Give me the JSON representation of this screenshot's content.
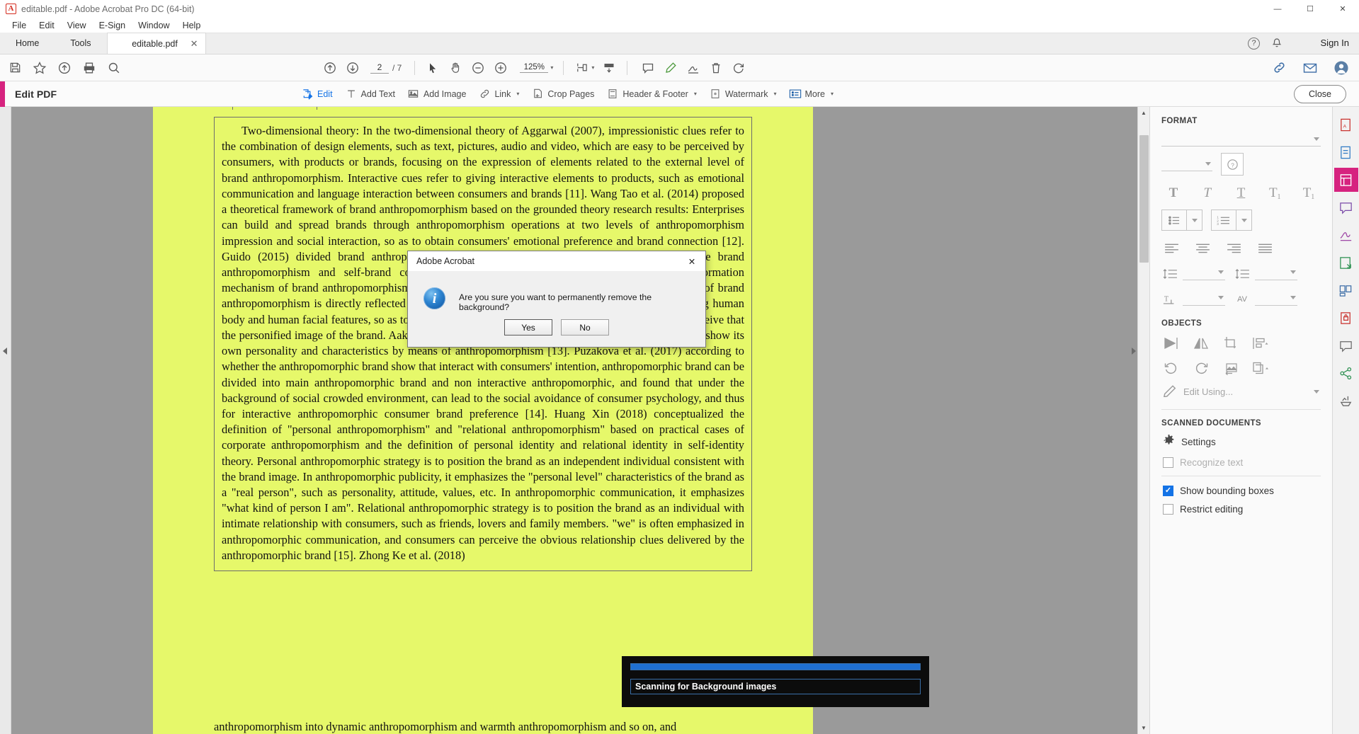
{
  "window": {
    "title": "editable.pdf - Adobe Acrobat Pro DC (64-bit)",
    "app_icon": "acrobat-icon",
    "minimize": "—",
    "maximize": "☐",
    "close": "✕"
  },
  "menubar": {
    "items": [
      "File",
      "Edit",
      "View",
      "E-Sign",
      "Window",
      "Help"
    ]
  },
  "tabs": {
    "home": "Home",
    "tools": "Tools",
    "document": "editable.pdf",
    "close_glyph": "✕",
    "sign_in": "Sign In",
    "help_icon": "?",
    "bell_icon": "bell-icon"
  },
  "toolbar": {
    "left_icons": [
      "save-icon",
      "star-icon",
      "upload-cloud-icon",
      "print-icon",
      "search-icon"
    ],
    "page_up_icon": "page-up-icon",
    "page_down_icon": "page-down-icon",
    "page_current": "2",
    "page_total": "/ 7",
    "select_icon": "select-cursor-icon",
    "hand_icon": "hand-tool-icon",
    "zoom_out_icon": "zoom-out-icon",
    "zoom_in_icon": "zoom-in-icon",
    "zoom_level": "125%",
    "zoom_caret": "▾",
    "fit_page_icon": "fit-page-icon",
    "fit_caret": "▾",
    "scroll_mode_icon": "scroll-mode-icon",
    "comment_icon": "comment-icon",
    "highlight_icon": "highlight-pen-icon",
    "sign_icon": "sign-icon",
    "delete_icon": "trash-icon",
    "rotate_icon": "rotate-icon",
    "link_share_icon": "share-link-icon",
    "mail_icon": "envelope-icon",
    "account_icon": "account-icon"
  },
  "edit_pdf_bar": {
    "title": "Edit PDF",
    "tools": [
      {
        "label": "Edit",
        "icon": "edit-pdf-icon",
        "active": true,
        "caret": ""
      },
      {
        "label": "Add Text",
        "icon": "add-text-icon",
        "active": false,
        "caret": ""
      },
      {
        "label": "Add Image",
        "icon": "add-image-icon",
        "active": false,
        "caret": ""
      },
      {
        "label": "Link",
        "icon": "link-icon",
        "active": false,
        "caret": "▾"
      },
      {
        "label": "Crop Pages",
        "icon": "crop-pages-icon",
        "active": false,
        "caret": ""
      },
      {
        "label": "Header & Footer",
        "icon": "header-footer-icon",
        "active": false,
        "caret": "▾"
      },
      {
        "label": "Watermark",
        "icon": "watermark-icon",
        "active": false,
        "caret": "▾"
      },
      {
        "label": "More",
        "icon": "more-icon",
        "active": false,
        "caret": "▾"
      }
    ],
    "close_label": "Close"
  },
  "document": {
    "body_text": "Two-dimensional theory: In the two-dimensional theory of Aggarwal (2007), impressionistic clues refer to the combination of design elements, such as text, pictures, audio and video, which are easy to be perceived by consumers, with products or brands, focusing on the expression of elements related to the external level of brand anthropomorphism. Interactive cues refer to giving interactive elements to products, such as emotional communication and language interaction between consumers and brands [11]. Wang Tao et al. (2014) proposed a theoretical framework of brand anthropomorphism based on the grounded theory research results: Enterprises can build and spread brands through anthropomorphism operations at two levels of anthropomorphism impression and social interaction, so as to obtain consumers' emotional preference and brand connection [12]. Guido (2015) divided brand anthropomorphism into product brand anthropomorphism, corporate brand anthropomorphism and self-brand consistency brand anthropomorphism, and discussed the formation mechanism of brand anthropomorphism in his study. The study found that the formation mechanism of brand anthropomorphism is directly reflected in the product shape design of the enterprise, including having human body and human facial features, so as to make the personified image of the brand make consumers perceive that the personified image of the brand. Aaker (1997) pointed out that the personified image of a brand can show its own personality and characteristics by means of anthropomorphism [13]. Puzakova et al. (2017) according to whether the anthropomorphic brand show that interact with consumers' intention, anthropomorphic brand can be divided into main anthropomorphic brand and non interactive anthropomorphic, and found that under the background of social crowded environment, can lead to the social avoidance of consumer psychology, and thus for interactive anthropomorphic consumer brand preference [14]. Huang Xin (2018) conceptualized the definition of \"personal anthropomorphism\" and \"relational anthropomorphism\" based on practical cases of corporate anthropomorphism and the definition of personal identity and relational identity in self-identity theory. Personal anthropomorphic strategy is to position the brand as an independent individual consistent with the brand image. In anthropomorphic publicity, it emphasizes the \"personal level\" characteristics of the brand as a \"real person\", such as personality, attitude, values, etc. In anthropomorphic communication, it emphasizes \"what kind of person I am\". Relational anthropomorphic strategy is to position the brand as an individual with intimate relationship with consumers, such as friends, lovers and family members. \"we\" is often emphasized in anthropomorphic communication, and consumers can perceive the obvious relationship clues delivered by the anthropomorphic brand [15]. Zhong Ke et al. (2018)",
    "clipped_line": "anthropomorphism into dynamic anthropomorphism and warmth anthropomorphism and so on, and",
    "highlight_color": "#e6f86a"
  },
  "dialog": {
    "title": "Adobe Acrobat",
    "close_glyph": "✕",
    "icon": "info-icon",
    "message": "Are you sure you want to permanently remove the background?",
    "yes_label": "Yes",
    "no_label": "No"
  },
  "right_panel": {
    "format": {
      "heading": "FORMAT",
      "font_value": "",
      "font_caret": "▾",
      "size_value": "",
      "size_caret": "▾",
      "color_icon": "color-picker-icon",
      "text_styles": [
        {
          "icon": "bold-icon",
          "glyph": "T"
        },
        {
          "icon": "italic-icon",
          "glyph": "T"
        },
        {
          "icon": "underline-icon",
          "glyph": "T"
        },
        {
          "icon": "superscript-icon",
          "glyph": "T"
        },
        {
          "icon": "subscript-icon",
          "glyph": "T"
        }
      ],
      "bullet_list_icon": "bullet-list-icon",
      "numbered_list_icon": "numbered-list-icon",
      "align_icons": [
        "align-left-icon",
        "align-center-icon",
        "align-right-icon",
        "align-justify-icon"
      ],
      "line_spacing_icon": "line-spacing-icon",
      "paragraph_spacing_icon": "paragraph-spacing-icon",
      "char_spacing_icon": "character-spacing-icon",
      "word_spacing_icon": "word-spacing-icon",
      "av_label": "AV",
      "horizontal_scale_icon": "horizontal-scale-icon"
    },
    "objects": {
      "heading": "OBJECTS",
      "icons_row1": [
        "flip-vertical-icon",
        "flip-horizontal-icon",
        "crop-object-icon",
        "align-objects-icon"
      ],
      "icons_row2": [
        "rotate-ccw-icon",
        "rotate-cw-icon",
        "replace-image-icon",
        "arrange-icon"
      ],
      "edit_using_label": "Edit Using...",
      "edit_using_icon": "pencil-icon",
      "edit_using_caret": "▾"
    },
    "scanned_documents": {
      "heading": "SCANNED DOCUMENTS",
      "settings_label": "Settings",
      "settings_icon": "gear-icon",
      "recognize_text_label": "Recognize text",
      "recognize_text_checked": false
    },
    "options": [
      {
        "label": "Show bounding boxes",
        "checked": true
      },
      {
        "label": "Restrict editing",
        "checked": false
      }
    ]
  },
  "icon_rail": {
    "items": [
      "export-pdf-icon",
      "create-pdf-icon",
      "edit-pdf-icon",
      "comment-icon",
      "fill-sign-icon",
      "send-review-icon",
      "organize-pages-icon",
      "protect-icon",
      "chat-icon",
      "share-icon",
      "more-tools-icon"
    ]
  },
  "progress": {
    "message": "Scanning for Background images",
    "percent": 100,
    "bar_color": "#1f6fd0"
  }
}
